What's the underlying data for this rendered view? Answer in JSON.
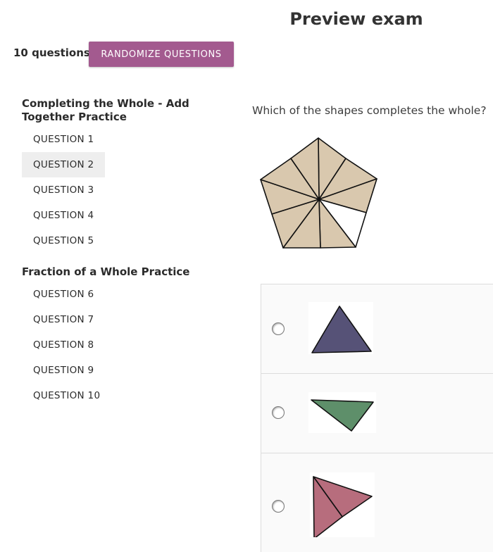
{
  "header": {
    "title": "Preview exam"
  },
  "toolbar": {
    "question_count": "10 questions",
    "randomize_label": "RANDOMIZE QUESTIONS"
  },
  "sidebar": {
    "sections": [
      {
        "title": "Completing the Whole - Add Together Practice",
        "questions": [
          "QUESTION 1",
          "QUESTION 2",
          "QUESTION 3",
          "QUESTION 4",
          "QUESTION 5"
        ]
      },
      {
        "title": "Fraction of a Whole Practice",
        "questions": [
          "QUESTION 6",
          "QUESTION 7",
          "QUESTION 8",
          "QUESTION 9",
          "QUESTION 10"
        ]
      }
    ],
    "selected_question": "QUESTION 2"
  },
  "question": {
    "prompt": "Which of the shapes completes the whole?",
    "figure": {
      "shape": "pentagon",
      "total_parts": 10,
      "shaded_parts": 9,
      "fill_color": "#d9c8ae"
    },
    "answers": [
      {
        "icon": "purple-triangle",
        "color": "#565277",
        "selected": false
      },
      {
        "icon": "green-triangle",
        "color": "#5e8f6a",
        "selected": false
      },
      {
        "icon": "pink-double-triangle",
        "color": "#b76d7d",
        "selected": false
      }
    ]
  },
  "colors": {
    "accent": "#a35a8f",
    "selected_row": "#eeeeee"
  }
}
